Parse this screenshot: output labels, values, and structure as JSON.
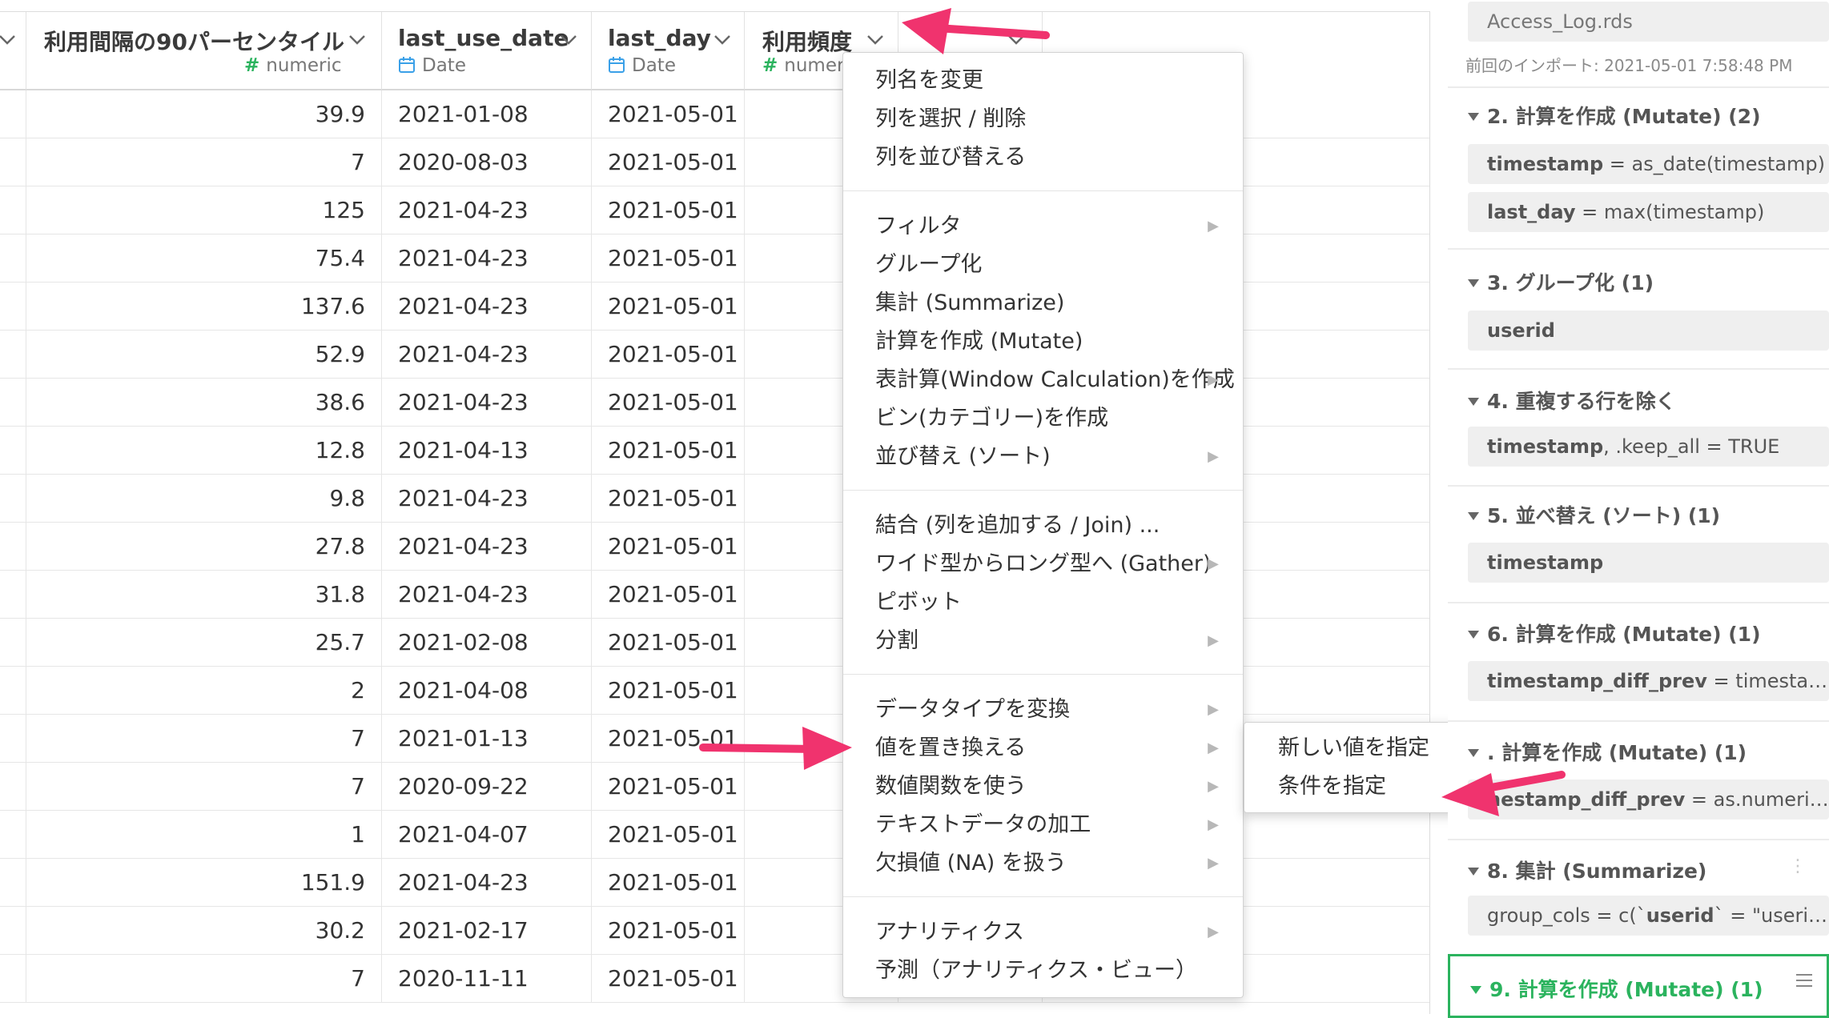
{
  "columns": [
    {
      "name": "利用間隔の90パーセンタイル",
      "type": "numeric"
    },
    {
      "name": "last_use_date",
      "type": "Date"
    },
    {
      "name": "last_day",
      "type": "Date"
    },
    {
      "name": "利用頻度",
      "type": "numeri"
    }
  ],
  "rows": [
    {
      "c1": "39.9",
      "c2": "2021-01-08",
      "c3": "2021-05-01"
    },
    {
      "c1": "7",
      "c2": "2020-08-03",
      "c3": "2021-05-01"
    },
    {
      "c1": "125",
      "c2": "2021-04-23",
      "c3": "2021-05-01"
    },
    {
      "c1": "75.4",
      "c2": "2021-04-23",
      "c3": "2021-05-01"
    },
    {
      "c1": "137.6",
      "c2": "2021-04-23",
      "c3": "2021-05-01"
    },
    {
      "c1": "52.9",
      "c2": "2021-04-23",
      "c3": "2021-05-01"
    },
    {
      "c1": "38.6",
      "c2": "2021-04-23",
      "c3": "2021-05-01"
    },
    {
      "c1": "12.8",
      "c2": "2021-04-13",
      "c3": "2021-05-01"
    },
    {
      "c1": "9.8",
      "c2": "2021-04-23",
      "c3": "2021-05-01"
    },
    {
      "c1": "27.8",
      "c2": "2021-04-23",
      "c3": "2021-05-01"
    },
    {
      "c1": "31.8",
      "c2": "2021-04-23",
      "c3": "2021-05-01"
    },
    {
      "c1": "25.7",
      "c2": "2021-02-08",
      "c3": "2021-05-01"
    },
    {
      "c1": "2",
      "c2": "2021-04-08",
      "c3": "2021-05-01"
    },
    {
      "c1": "7",
      "c2": "2021-01-13",
      "c3": "2021-05-01"
    },
    {
      "c1": "7",
      "c2": "2020-09-22",
      "c3": "2021-05-01"
    },
    {
      "c1": "1",
      "c2": "2021-04-07",
      "c3": "2021-05-01"
    },
    {
      "c1": "151.9",
      "c2": "2021-04-23",
      "c3": "2021-05-01"
    },
    {
      "c1": "30.2",
      "c2": "2021-02-17",
      "c3": "2021-05-01"
    },
    {
      "c1": "7",
      "c2": "2020-11-11",
      "c3": "2021-05-01"
    }
  ],
  "menu": {
    "g1": [
      "列名を変更",
      "列を選択 / 削除",
      "列を並び替える"
    ],
    "g2": [
      "フィルタ",
      "グループ化",
      "集計 (Summarize)",
      "計算を作成 (Mutate)",
      "表計算(Window Calculation)を作成",
      "ビン(カテゴリー)を作成",
      "並び替え (ソート)"
    ],
    "g3": [
      "結合 (列を追加する / Join) ...",
      "ワイド型からロング型へ (Gather)",
      "ピボット",
      "分割"
    ],
    "g4": [
      "データタイプを変換",
      "値を置き換える",
      "数値関数を使う",
      "テキストデータの加工",
      "欠損値 (NA) を扱う"
    ],
    "g5": [
      "アナリティクス",
      "予測（アナリティクス・ビュー）"
    ],
    "submenu_icon": "chevron-right"
  },
  "submenu": [
    "新しい値を指定",
    "条件を指定"
  ],
  "panel": {
    "source_file": "Access_Log.rds",
    "import_info": "前回のインポート: 2021-05-01 7:58:48 PM",
    "steps": [
      {
        "title": "2. 計算を作成 (Mutate) (2)"
      },
      {
        "title": "3. グループ化 (1)"
      },
      {
        "title": "4. 重複する行を除く"
      },
      {
        "title": "5. 並べ替え (ソート) (1)"
      },
      {
        "title": "6. 計算を作成 (Mutate) (1)"
      },
      {
        "title": ". 計算を作成 (Mutate) (1)"
      },
      {
        "title": "8. 集計 (Summarize)"
      },
      {
        "title": "9. 計算を作成 (Mutate) (1)"
      }
    ],
    "boxes": [
      {
        "key": "timestamp",
        "rest": " = as_date(timestamp)"
      },
      {
        "key": "last_day",
        "rest": " = max(timestamp)"
      },
      {
        "key": "userid",
        "rest": ""
      },
      {
        "key": "timestamp",
        "rest": ", .keep_all = TRUE"
      },
      {
        "key": "timestamp",
        "rest": ""
      },
      {
        "key": "timestamp_diff_prev",
        "rest": " = timestamp …"
      },
      {
        "key": "nestamp_diff_prev",
        "rest": " = as.numeric(…"
      },
      {
        "pre": "group_cols = c(`",
        "key": "userid",
        "rest": "` = \"userid\"),g…"
      }
    ]
  },
  "accent_color": "#2bb35e",
  "arrow_color": "#f0336e"
}
